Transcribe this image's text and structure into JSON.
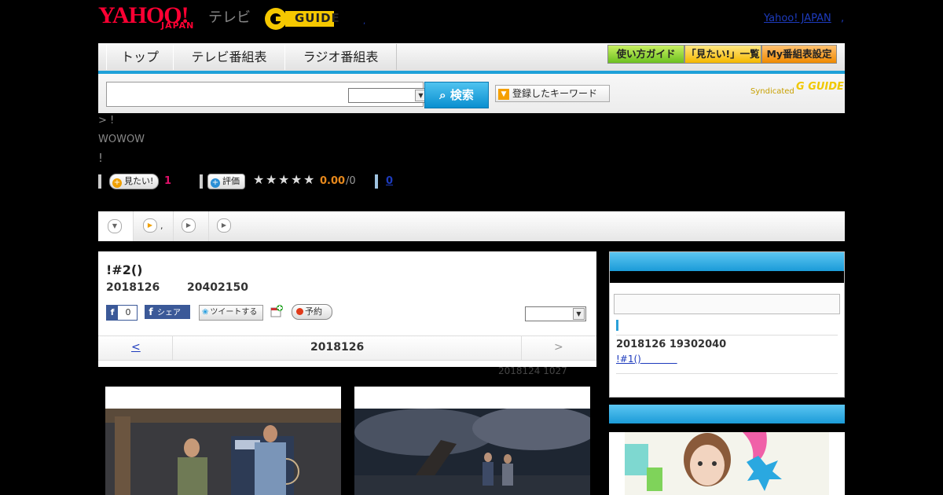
{
  "header": {
    "logo_main": "YAHOO!",
    "logo_sub": "JAPAN",
    "logo_tv": "テレビ",
    "logo_gguide": "GUIDE",
    "mini_dot": ",",
    "yahoo_link": "Yahoo! JAPAN",
    "link_sep": ","
  },
  "nav": {
    "tabs": [
      {
        "label": "トップ"
      },
      {
        "label": "テレビ番組表"
      },
      {
        "label": "ラジオ番組表"
      }
    ],
    "buttons": [
      {
        "label": "使い方ガイド"
      },
      {
        "label": "「見たい!」一覧"
      },
      {
        "label": "My番組表設定"
      }
    ]
  },
  "search": {
    "input_value": "",
    "select_value": "",
    "button_label": "検索",
    "keyword_button": "登録したキーワード",
    "syndicated_label": "Syndicated",
    "gguide_mark": "G GUIDE"
  },
  "breadcrumb": "> !",
  "channel": "WOWOW",
  "show_short_title": "!",
  "stats": {
    "mitai_label": "見たい!",
    "mitai_count": "1",
    "hyouka_label": "評価",
    "stars": 0,
    "rating": "0.00",
    "rating_count": "/0",
    "review_count": "0"
  },
  "tabs_strip": {
    "tab1_label": "",
    "tab2_label": ",",
    "tab3_label": "",
    "tab4_label": ""
  },
  "program": {
    "title": "!#2()",
    "date": "2018126",
    "time": "20402150",
    "fb_like_count": "0",
    "fb_share_label": "シェア",
    "tweet_label": "ツイートする",
    "reserve_label": "予約",
    "select_value": "",
    "pager_prev": "<",
    "pager_date": "2018126",
    "pager_next": ">",
    "updated": "2018124  1027"
  },
  "sidebar": {
    "search_value": "",
    "next_date": "2018126  19302040",
    "next_link": "!#1()"
  },
  "colors": {
    "accent_blue": "#1ea0d8",
    "brand_red": "#ff0033",
    "link_blue": "#1d3bbd",
    "rating_orange": "#e8891c",
    "count_pink": "#e0106a"
  }
}
